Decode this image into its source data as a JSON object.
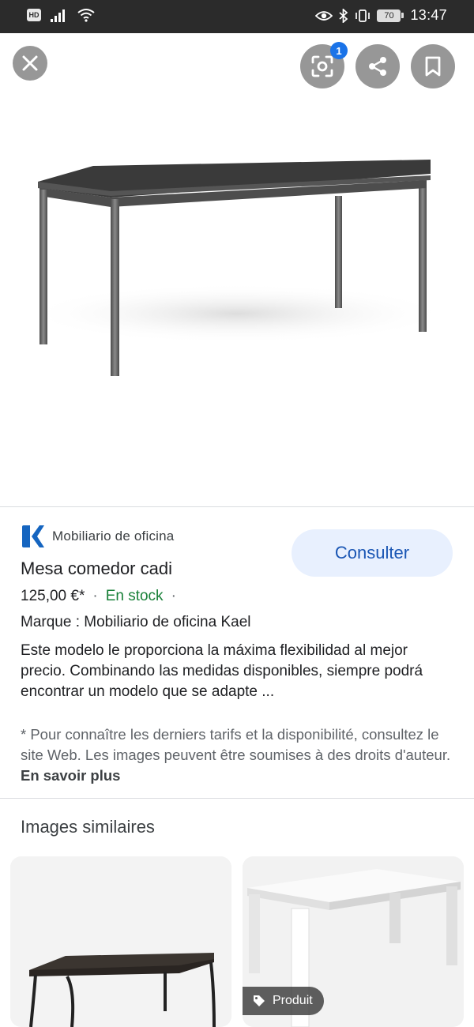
{
  "status_bar": {
    "hd_label": "HD",
    "battery": "70",
    "time": "13:47"
  },
  "viewer": {
    "badge_count": "1",
    "icons": [
      "close-icon",
      "lens-icon",
      "share-icon",
      "bookmark-icon"
    ]
  },
  "result": {
    "source_name": "Mobiliario de oficina",
    "consult_label": "Consulter",
    "title": "Mesa comedor cadi",
    "price": "125,00 €*",
    "price_sep": "·",
    "stock": "En stock",
    "stock_sep": "·",
    "brand": "Marque : Mobiliario de oficina Kael",
    "description": "Este modelo le proporciona la máxima flexibilidad al mejor precio. Combinando las medidas disponibles, siempre podrá encontrar un modelo que se adapte ...",
    "disclaimer": "* Pour connaître les derniers tarifs et la disponibilité, consultez le site Web. Les images peuvent être soumises à des droits d'auteur.",
    "learn_more": "En savoir plus"
  },
  "similar": {
    "title": "Images similaires",
    "product_chip": "Produit"
  },
  "colors": {
    "accent": "#1a73e8",
    "consult_bg": "#e8f0fe",
    "in_stock": "#188038",
    "brand_logo": "#1565c0"
  }
}
